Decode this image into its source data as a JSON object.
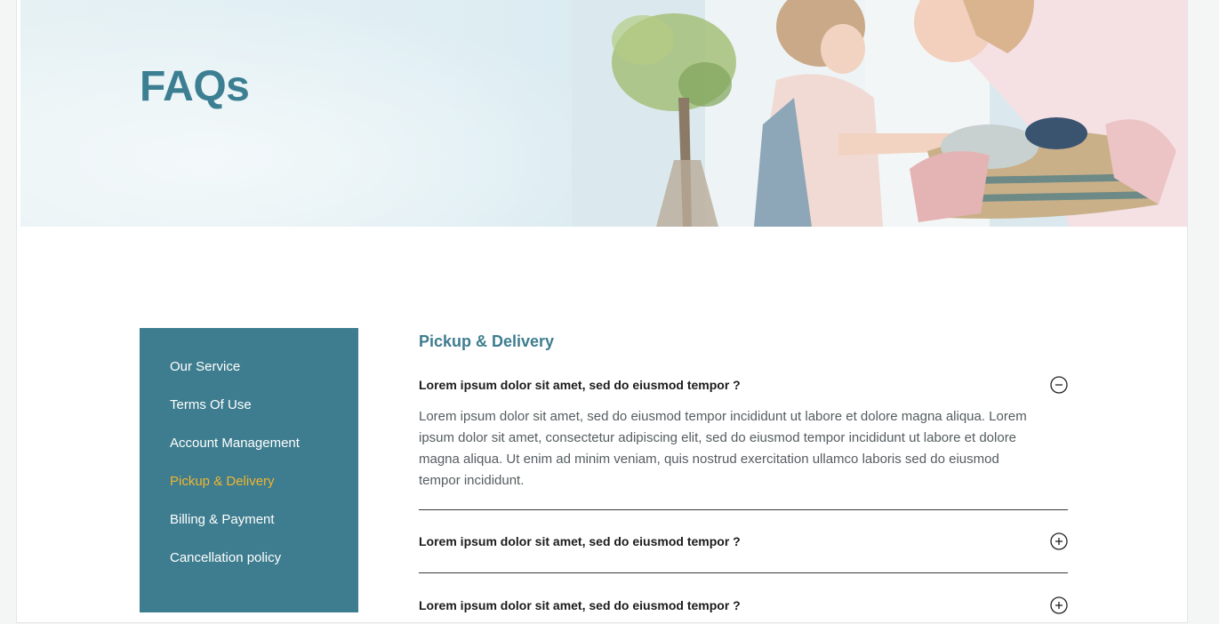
{
  "hero": {
    "title": "FAQs"
  },
  "sidebar": {
    "items": [
      {
        "label": "Our Service",
        "active": false
      },
      {
        "label": "Terms Of Use",
        "active": false
      },
      {
        "label": "Account Management",
        "active": false
      },
      {
        "label": "Pickup & Delivery",
        "active": true
      },
      {
        "label": "Billing & Payment",
        "active": false
      },
      {
        "label": "Cancellation policy",
        "active": false
      }
    ]
  },
  "section": {
    "title": "Pickup & Delivery",
    "faqs": [
      {
        "question": "Lorem ipsum dolor sit amet, sed do eiusmod tempor ?",
        "answer": "Lorem ipsum dolor sit amet, sed do eiusmod tempor incididunt ut labore et dolore magna aliqua. Lorem ipsum dolor sit amet, consectetur adipiscing elit, sed do eiusmod tempor incididunt ut labore et dolore magna aliqua. Ut enim ad minim veniam, quis nostrud exercitation ullamco laboris sed do eiusmod tempor incididunt.",
        "expanded": true,
        "icon": "minus-circle-icon"
      },
      {
        "question": "Lorem ipsum dolor sit amet, sed do eiusmod tempor ?",
        "expanded": false,
        "icon": "plus-circle-icon"
      },
      {
        "question": "Lorem ipsum dolor sit amet, sed do eiusmod tempor ?",
        "expanded": false,
        "icon": "plus-circle-icon"
      }
    ]
  },
  "colors": {
    "brand": "#3e7d8f",
    "active": "#f0b530",
    "title": "#3c7f92"
  }
}
